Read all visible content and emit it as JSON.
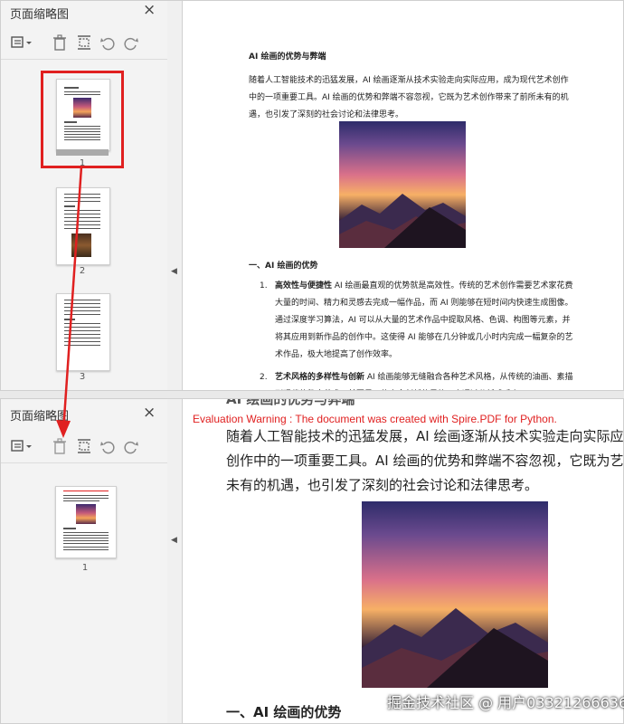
{
  "top": {
    "sidebar": {
      "title": "页面缩略图",
      "close_icon": "×",
      "thumbnails": [
        {
          "label": "1"
        },
        {
          "label": "2"
        },
        {
          "label": "3"
        }
      ]
    },
    "document": {
      "heading": "AI 绘画的优势与弊端",
      "intro": "随着人工智能技术的迅猛发展，AI 绘画逐渐从技术实验走向实际应用，成为现代艺术创作中的一项重要工具。AI 绘画的优势和弊端不容忽视，它既为艺术创作带来了前所未有的机遇，也引发了深刻的社会讨论和法律思考。",
      "section": "一、AI 绘画的优势",
      "items": [
        {
          "num": "1.",
          "term": "高效性与便捷性",
          "text": " AI 绘画最直观的优势就是高效性。传统的艺术创作需要艺术家花费大量的时间、精力和灵感去完成一幅作品，而 AI 则能够在短时间内快速生成图像。通过深度学习算法，AI 可以从大量的艺术作品中提取风格、色调、构图等元素，并将其应用到新作品的创作中。这使得 AI 能够在几分钟或几小时内完成一幅复杂的艺术作品，极大地提高了创作效率。"
        },
        {
          "num": "2.",
          "term": "艺术风格的多样性与创新",
          "text": " AI 绘画能够无缝融合各种艺术风格，从传统的油画、素描到现代的数字艺术，甚至是一些完全创新的风格。它通过分析成千上"
        }
      ]
    }
  },
  "bottom": {
    "sidebar": {
      "title": "页面缩略图",
      "close_icon": "×",
      "thumbnails": [
        {
          "label": "1"
        }
      ]
    },
    "document": {
      "warning": "Evaluation Warning : The document was created with Spire.PDF for Python.",
      "heading_partial": "AI 绘画的优势与弊端",
      "intro_lines": [
        "随着人工智能技术的迅猛发展，AI 绘画逐渐从技术实验走向实际应用，成为",
        "创作中的一项重要工具。AI 绘画的优势和弊端不容忽视，它既为艺术创作带",
        "未有的机遇，也引发了深刻的社会讨论和法律思考。"
      ],
      "section": "一、AI 绘画的优势"
    }
  },
  "watermark": "掘金技术社区 @ 用户033212666367",
  "colors": {
    "highlight": "#e02020",
    "warning": "#e02020"
  },
  "icons": [
    "options-menu-icon",
    "delete-icon",
    "extract-page-icon",
    "rotate-left-icon",
    "rotate-right-icon",
    "close-icon",
    "collapse-arrow-icon"
  ]
}
